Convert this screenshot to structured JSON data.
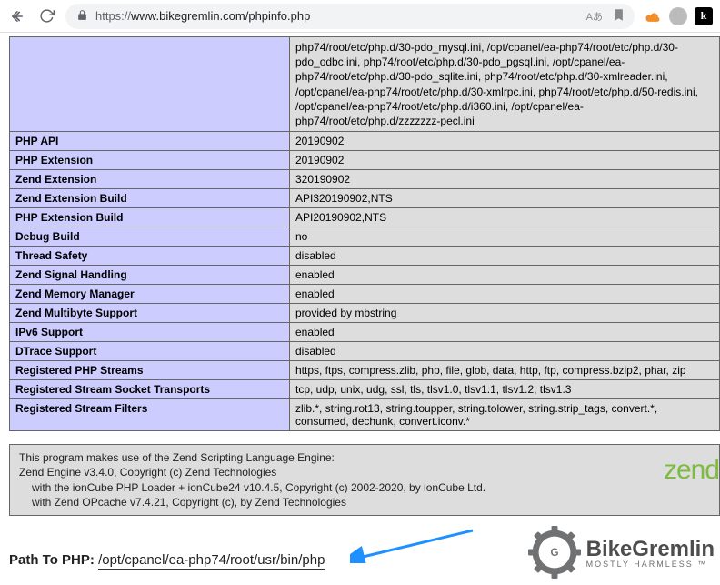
{
  "browser": {
    "url_proto": "https://",
    "url_rest": "www.bikegremlin.com/phpinfo.php",
    "translate_icon": "Aあ"
  },
  "table": {
    "top_value": "php74/root/etc/php.d/30-pdo_mysql.ini, /opt/cpanel/ea-php74/root/etc/php.d/30-pdo_odbc.ini, php74/root/etc/php.d/30-pdo_pgsql.ini, /opt/cpanel/ea-php74/root/etc/php.d/30-pdo_sqlite.ini, php74/root/etc/php.d/30-xmlreader.ini, /opt/cpanel/ea-php74/root/etc/php.d/30-xmlrpc.ini, php74/root/etc/php.d/50-redis.ini, /opt/cpanel/ea-php74/root/etc/php.d/i360.ini, /opt/cpanel/ea-php74/root/etc/php.d/zzzzzzz-pecl.ini",
    "rows": [
      {
        "label": "PHP API",
        "value": "20190902"
      },
      {
        "label": "PHP Extension",
        "value": "20190902"
      },
      {
        "label": "Zend Extension",
        "value": "320190902"
      },
      {
        "label": "Zend Extension Build",
        "value": "API320190902,NTS"
      },
      {
        "label": "PHP Extension Build",
        "value": "API20190902,NTS"
      },
      {
        "label": "Debug Build",
        "value": "no"
      },
      {
        "label": "Thread Safety",
        "value": "disabled"
      },
      {
        "label": "Zend Signal Handling",
        "value": "enabled"
      },
      {
        "label": "Zend Memory Manager",
        "value": "enabled"
      },
      {
        "label": "Zend Multibyte Support",
        "value": "provided by mbstring"
      },
      {
        "label": "IPv6 Support",
        "value": "enabled"
      },
      {
        "label": "DTrace Support",
        "value": "disabled"
      },
      {
        "label": "Registered PHP Streams",
        "value": "https, ftps, compress.zlib, php, file, glob, data, http, ftp, compress.bzip2, phar, zip"
      },
      {
        "label": "Registered Stream Socket Transports",
        "value": "tcp, udp, unix, udg, ssl, tls, tlsv1.0, tlsv1.1, tlsv1.2, tlsv1.3"
      },
      {
        "label": "Registered Stream Filters",
        "value": "zlib.*, string.rot13, string.toupper, string.tolower, string.strip_tags, convert.*, consumed, dechunk, convert.iconv.*"
      }
    ]
  },
  "footer": {
    "line1": "This program makes use of the Zend Scripting Language Engine:",
    "line2": "Zend Engine v3.4.0, Copyright (c) Zend Technologies",
    "line3": "with the ionCube PHP Loader + ionCube24 v10.4.5, Copyright (c) 2002-2020, by ionCube Ltd.",
    "line4": "with Zend OPcache v7.4.21, Copyright (c), by Zend Technologies",
    "zend_logo": "zend"
  },
  "path": {
    "label": "Path To PHP: ",
    "value": "/opt/cpanel/ea-php74/root/usr/bin/php"
  },
  "bikegremlin": {
    "name": "BikeGremlin",
    "tag": "MOSTLY HARMLESS ™"
  }
}
